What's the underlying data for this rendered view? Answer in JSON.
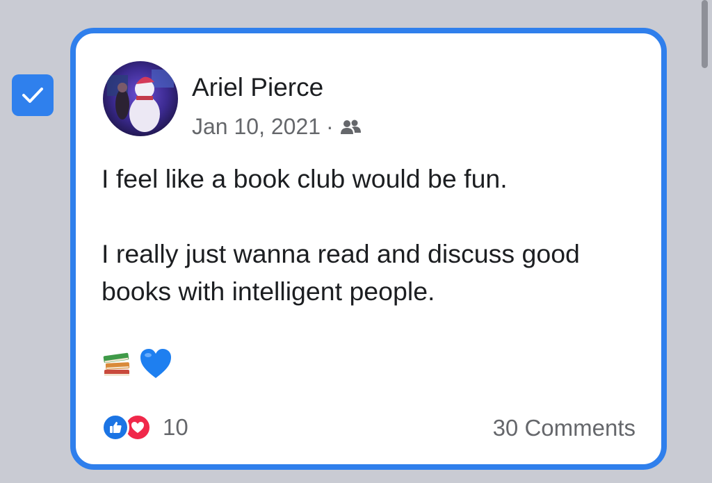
{
  "post": {
    "author": "Ariel Pierce",
    "date": "Jan 10, 2021",
    "separator": "·",
    "audience_icon": "friends-icon",
    "paragraphs": [
      "I feel like a book club would be fun.",
      "I really just wanna read and discuss good books with intelligent people."
    ],
    "emojis": [
      "books-emoji",
      "blue-heart-emoji"
    ],
    "reactions": {
      "icons": [
        "like-icon",
        "love-icon"
      ],
      "count": "10"
    },
    "comments_label": "30 Comments"
  },
  "selection": {
    "checked": true
  },
  "colors": {
    "background": "#c9cbd3",
    "card_border": "#2f7fec",
    "checkbox": "#2f80ed",
    "like": "#1b74e4",
    "love": "#f0284a",
    "secondary_text": "#65676b"
  }
}
